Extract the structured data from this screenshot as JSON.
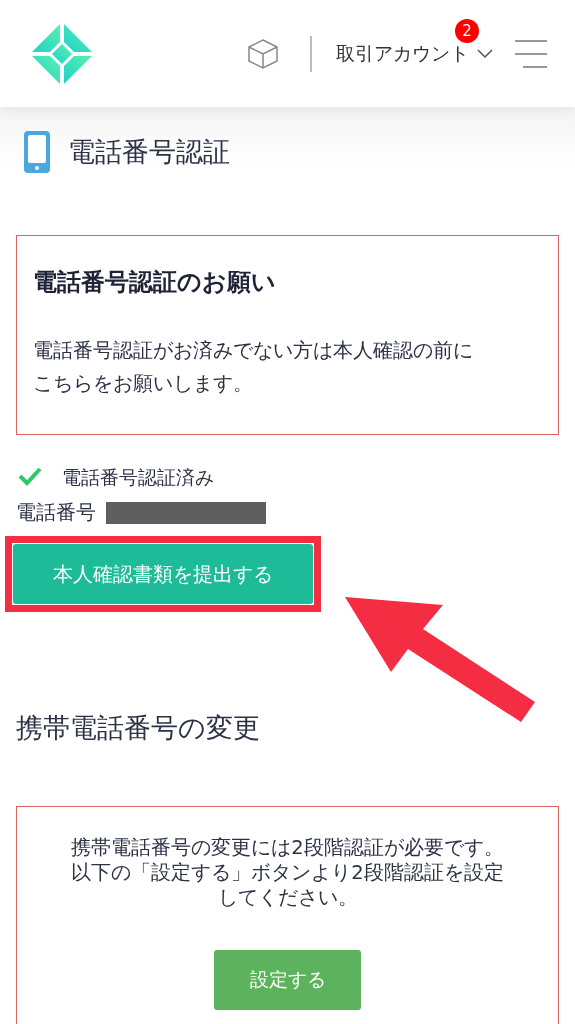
{
  "header": {
    "account_menu": "取引アカウント",
    "badge": "2"
  },
  "page_title": "電話番号認証",
  "notice": {
    "heading": "電話番号認証のお願い",
    "lines": [
      "電話番号認証がお済みでない方は本人確認の前に",
      "こちらをお願いします。"
    ]
  },
  "verification": {
    "checked": true,
    "label": "電話番号認証済み"
  },
  "phone_label": "電話番号",
  "submit_button": "本人確認書類を提出する",
  "change_section": {
    "title": "携帯電話番号の変更",
    "lines": [
      "携帯電話番号の変更には2段階認証が必要です。",
      "以下の「設定する」ボタンより2段階認証を設定",
      "してください。"
    ],
    "button": "設定する"
  }
}
